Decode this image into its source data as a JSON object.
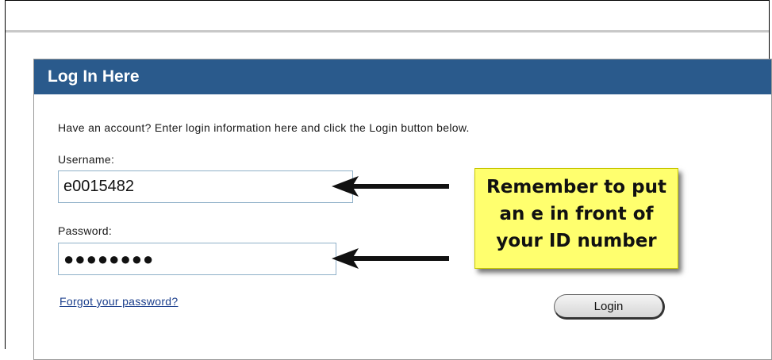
{
  "panel": {
    "title": "Log In Here",
    "intro": "Have an account? Enter login information here and click the Login button below."
  },
  "form": {
    "username_label": "Username:",
    "username_value": "e0015482",
    "password_label": "Password:",
    "password_value": "●●●●●●●●",
    "forgot_link": "Forgot your password?",
    "login_button": "Login"
  },
  "callout": {
    "lines": [
      "Remember to put",
      "an e in front of",
      "your ID number"
    ]
  },
  "colors": {
    "header_bg": "#2a5a8c",
    "callout_bg": "#ffff6e"
  }
}
